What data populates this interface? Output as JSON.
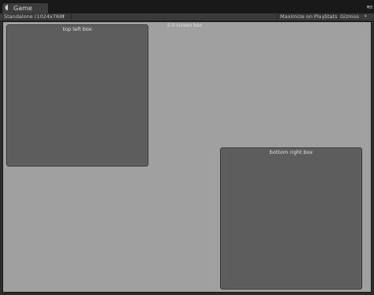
{
  "tab": {
    "title": "Game",
    "icon": "pacman-icon"
  },
  "toolbar": {
    "resolution": "Standalone (1024x768)",
    "resolution_arrow": "▾",
    "maximize_on_play": "Maximize on Play",
    "stats": "Stats",
    "gizmos": "Gizmos",
    "gizmos_arrow": "▾"
  },
  "viewport": {
    "floating_label": "5.0 screen box",
    "boxes": [
      {
        "label": "top left box"
      },
      {
        "label": "bottom right box"
      }
    ]
  },
  "colors": {
    "viewport_background": "#a0a0a0",
    "box_fill": "#5d5d5d",
    "toolbar_background": "#3a3a3a"
  }
}
